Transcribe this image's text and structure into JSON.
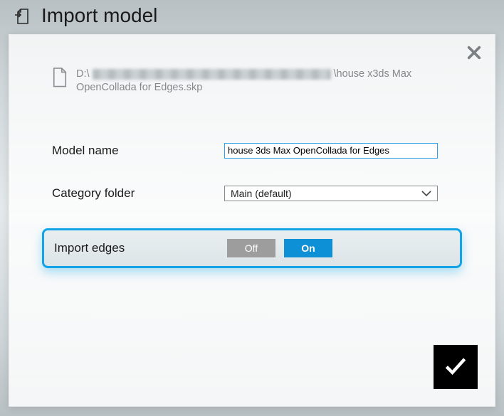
{
  "header": {
    "title": "Import model"
  },
  "file": {
    "prefix": "D:\\",
    "suffix": "\\house x3ds Max OpenCollada for Edges.skp"
  },
  "form": {
    "model_name_label": "Model name",
    "model_name_value": "house 3ds Max OpenCollada for Edges",
    "category_label": "Category folder",
    "category_value": "Main (default)"
  },
  "import_edges": {
    "label": "Import edges",
    "off": "Off",
    "on": "On",
    "selected": "on"
  }
}
